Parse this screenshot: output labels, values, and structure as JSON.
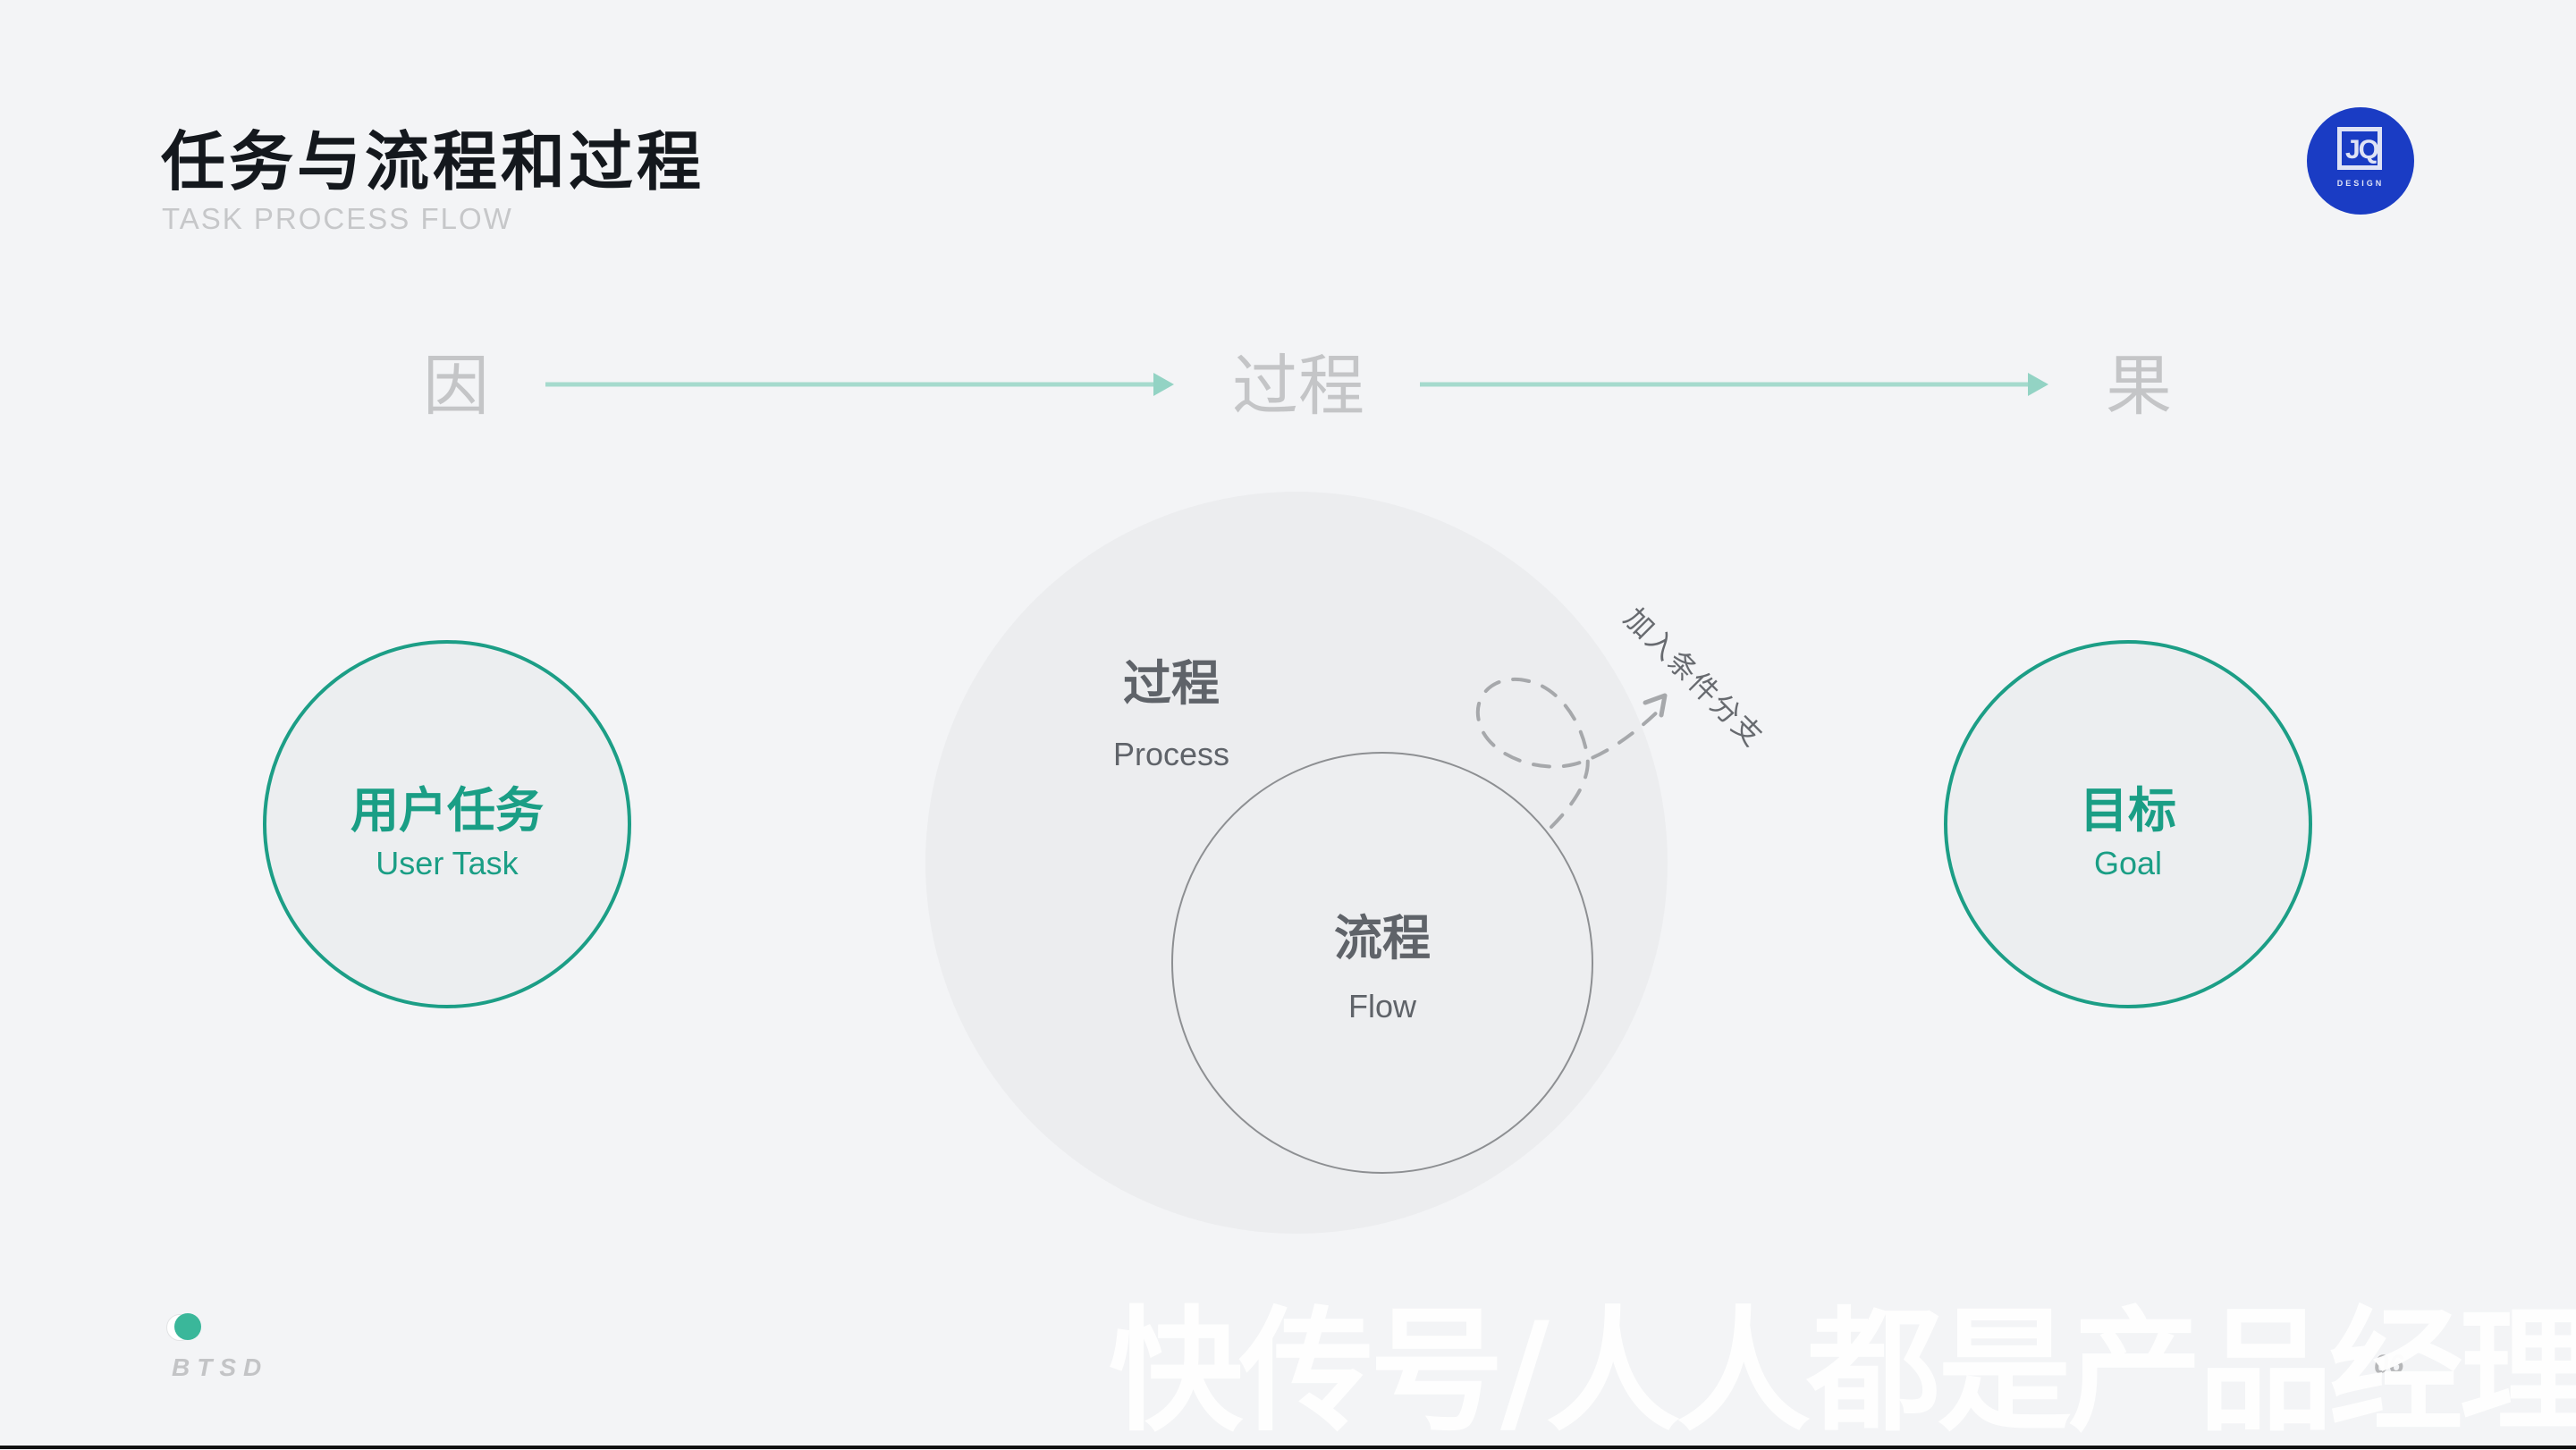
{
  "header": {
    "title": "任务与流程和过程",
    "subtitle": "TASK PROCESS FLOW"
  },
  "logo": {
    "mark": "JQ",
    "text": "DESIGN",
    "color": "#1a3cc4"
  },
  "flow_row": {
    "cause": "因",
    "process": "过程",
    "effect": "果",
    "arrow_color": "#9bd6c9"
  },
  "diagram": {
    "user_task": {
      "title": "用户任务",
      "subtitle": "User Task"
    },
    "process": {
      "title": "过程",
      "subtitle": "Process"
    },
    "flow": {
      "title": "流程",
      "subtitle": "Flow"
    },
    "goal": {
      "title": "目标",
      "subtitle": "Goal"
    },
    "branch_annotation": "加入条件分支",
    "accent_color": "#1a9e85"
  },
  "footer": {
    "brand": "BTSD",
    "page_number": "06",
    "watermark": "快传号/人人都是产品经理"
  }
}
